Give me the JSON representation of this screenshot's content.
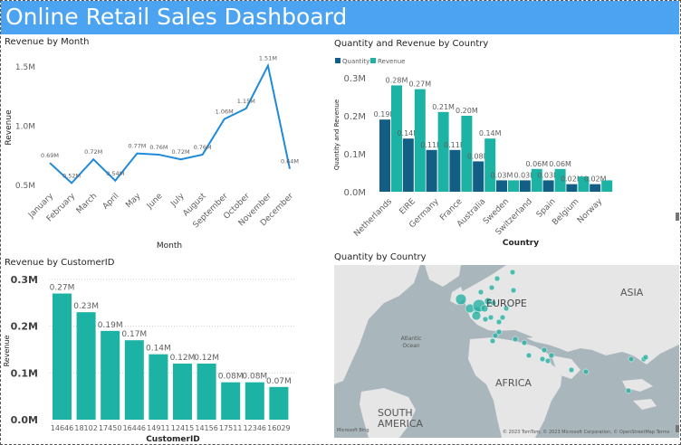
{
  "header": {
    "title": "Online Retail Sales Dashboard"
  },
  "colors": {
    "header": "#4ba3f2",
    "line": "#1f8ad9",
    "quantity": "#125e84",
    "revenue": "#1cb3a4",
    "map_bubble": "#2bb0a2"
  },
  "panels": {
    "revenue_by_month": {
      "title": "Revenue by Month"
    },
    "qty_rev_country": {
      "title": "Quantity and Revenue by Country",
      "legend": [
        "Quantity",
        "Revenue"
      ]
    },
    "revenue_by_customer": {
      "title": "Revenue by CustomerID"
    },
    "quantity_by_country_map": {
      "title": "Quantity by Country",
      "labels": {
        "europe": "EUROPE",
        "asia": "ASIA",
        "africa": "AFRICA",
        "south_america": "SOUTH AMERICA",
        "atlantic": "Atlantic Ocean"
      },
      "attribution": "© 2023 TomTom, © 2023 Microsoft Corporation, © OpenStreetMap Terms",
      "logo": "Microsoft Bing"
    }
  },
  "chart_data": [
    {
      "type": "line",
      "title": "Revenue by Month",
      "xlabel": "Month",
      "ylabel": "Revenue",
      "categories": [
        "January",
        "February",
        "March",
        "April",
        "May",
        "June",
        "July",
        "August",
        "September",
        "October",
        "November",
        "December"
      ],
      "values": [
        0.69,
        0.52,
        0.72,
        0.54,
        0.77,
        0.76,
        0.72,
        0.76,
        1.06,
        1.15,
        1.51,
        0.64
      ],
      "data_labels": [
        "0.69M",
        "0.52M",
        "0.72M",
        "0.54M",
        "0.77M",
        "0.76M",
        "0.72M",
        "0.76M",
        "1.06M",
        "1.15M",
        "1.51M",
        "0.64M"
      ],
      "yticks": [
        "0.5M",
        "1.0M",
        "1.5M"
      ],
      "ylim": [
        0.5,
        1.5
      ],
      "grid": false
    },
    {
      "type": "bar",
      "title": "Quantity and Revenue by Country",
      "xlabel": "Country",
      "ylabel": "Quantity and Revenue",
      "categories": [
        "Netherlands",
        "EIRE",
        "Germany",
        "France",
        "Australia",
        "Sweden",
        "Switzerland",
        "Spain",
        "Belgium",
        "Norway"
      ],
      "series": [
        {
          "name": "Quantity",
          "values": [
            0.19,
            0.14,
            0.11,
            0.11,
            0.08,
            0.03,
            0.03,
            0.03,
            0.02,
            0.02
          ]
        },
        {
          "name": "Revenue",
          "values": [
            0.28,
            0.27,
            0.21,
            0.2,
            0.14,
            0.03,
            0.06,
            0.06,
            0.04,
            0.03
          ]
        }
      ],
      "data_labels": {
        "Quantity": [
          "0.19M",
          "0.14M",
          "0.11M",
          "0.11M",
          "0.08M",
          "0.03M",
          "0.03M",
          "0.03M",
          "0.02M",
          "0.02M"
        ],
        "Revenue": [
          "0.28M",
          "0.27M",
          "0.21M",
          "0.20M",
          "0.14M",
          "",
          "0.06M",
          "0.06M",
          "",
          ""
        ]
      },
      "yticks": [
        "0.0M",
        "0.1M",
        "0.2M",
        "0.3M"
      ],
      "ylim": [
        0,
        0.3
      ],
      "legend": "top-left",
      "grid": false
    },
    {
      "type": "bar",
      "title": "Revenue by CustomerID",
      "xlabel": "CustomerID",
      "ylabel": "Revenue",
      "categories": [
        "14646",
        "18102",
        "17450",
        "16446",
        "14911",
        "12415",
        "14156",
        "17511",
        "12346",
        "16029"
      ],
      "values": [
        0.27,
        0.23,
        0.19,
        0.17,
        0.14,
        0.12,
        0.12,
        0.08,
        0.08,
        0.07
      ],
      "data_labels": [
        "0.27M",
        "0.23M",
        "0.19M",
        "0.17M",
        "0.14M",
        "0.12M",
        "0.12M",
        "0.08M",
        "0.08M",
        "0.07M"
      ],
      "yticks": [
        "0.0M",
        "0.1M",
        "0.2M",
        "0.3M"
      ],
      "ylim": [
        0,
        0.3
      ],
      "grid": true
    }
  ]
}
